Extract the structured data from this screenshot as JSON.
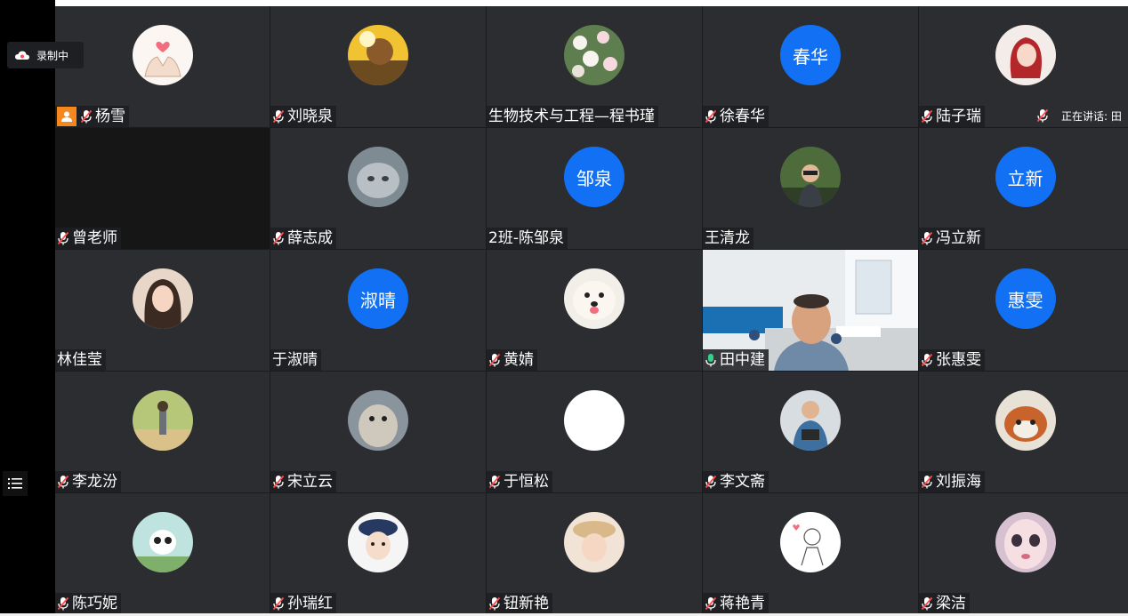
{
  "recording": {
    "label": "录制中"
  },
  "speaking": {
    "label": "正在讲话: 田"
  },
  "participants": [
    {
      "name": "杨雪",
      "avatar": "photo",
      "avatar_desc": "heart-hands",
      "host": true,
      "mic": "muted"
    },
    {
      "name": "刘晓泉",
      "avatar": "photo",
      "avatar_desc": "cartoon-character",
      "mic": "muted"
    },
    {
      "name": "生物技术与工程—程书瑾",
      "avatar": "photo",
      "avatar_desc": "flowers",
      "mic": "none"
    },
    {
      "name": "徐春华",
      "avatar": "text",
      "avatar_text": "春华",
      "mic": "muted"
    },
    {
      "name": "陆子瑞",
      "avatar": "photo",
      "avatar_desc": "anime-girl",
      "mic": "muted"
    },
    {
      "name": "曾老师",
      "avatar": "none",
      "mic": "muted"
    },
    {
      "name": "薛志成",
      "avatar": "photo",
      "avatar_desc": "cat",
      "mic": "muted"
    },
    {
      "name": "2班-陈邹泉",
      "avatar": "text",
      "avatar_text": "邹泉",
      "mic": "none"
    },
    {
      "name": "王清龙",
      "avatar": "photo",
      "avatar_desc": "man-in-forest",
      "mic": "none"
    },
    {
      "name": "冯立新",
      "avatar": "text",
      "avatar_text": "立新",
      "mic": "muted"
    },
    {
      "name": "林佳莹",
      "avatar": "photo",
      "avatar_desc": "girl-portrait",
      "mic": "none"
    },
    {
      "name": "于淑晴",
      "avatar": "text",
      "avatar_text": "淑晴",
      "mic": "none"
    },
    {
      "name": "黄婧",
      "avatar": "photo",
      "avatar_desc": "dog",
      "mic": "muted"
    },
    {
      "name": "田中建",
      "avatar": "video",
      "mic": "active"
    },
    {
      "name": "张惠雯",
      "avatar": "text",
      "avatar_text": "惠雯",
      "mic": "muted"
    },
    {
      "name": "李龙汾",
      "avatar": "photo",
      "avatar_desc": "anime-scene",
      "mic": "muted"
    },
    {
      "name": "宋立云",
      "avatar": "photo",
      "avatar_desc": "otter",
      "mic": "muted"
    },
    {
      "name": "于恒松",
      "avatar": "white",
      "mic": "muted"
    },
    {
      "name": "李文斋",
      "avatar": "photo",
      "avatar_desc": "man-with-camera",
      "mic": "muted"
    },
    {
      "name": "刘振海",
      "avatar": "photo",
      "avatar_desc": "red-panda",
      "mic": "muted"
    },
    {
      "name": "陈巧妮",
      "avatar": "photo",
      "avatar_desc": "panda-cartoon",
      "mic": "muted"
    },
    {
      "name": "孙瑞红",
      "avatar": "photo",
      "avatar_desc": "baby-with-hat",
      "mic": "muted"
    },
    {
      "name": "钮新艳",
      "avatar": "photo",
      "avatar_desc": "child-with-hat",
      "mic": "muted"
    },
    {
      "name": "蒋艳青",
      "avatar": "photo",
      "avatar_desc": "sketch-drawing",
      "mic": "muted"
    },
    {
      "name": "梁洁",
      "avatar": "photo",
      "avatar_desc": "doll-face",
      "mic": "muted"
    }
  ],
  "colors": {
    "tile": "#2b2d31",
    "text_avatar": "#1270f5",
    "host_badge": "#f5871f",
    "active_border": "#2fd48a",
    "muted_mic": "#ff4d4f",
    "active_mic": "#2fd48a"
  }
}
